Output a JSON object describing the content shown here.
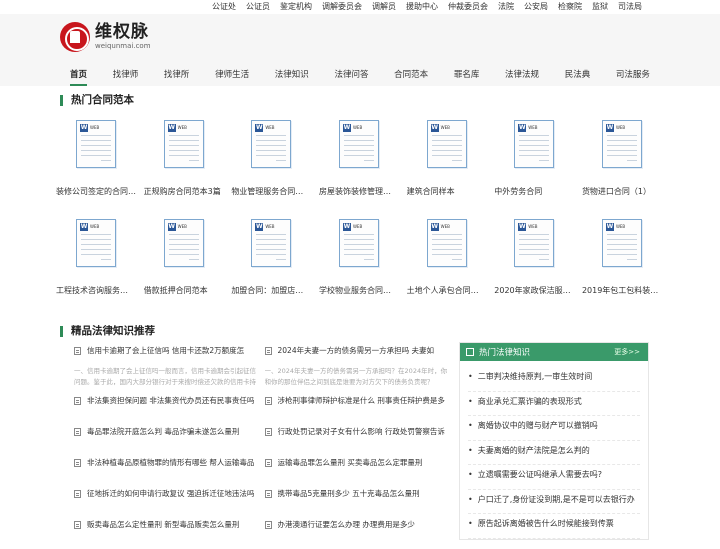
{
  "topbar": [
    "公证处",
    "公证员",
    "鉴定机构",
    "调解委员会",
    "调解员",
    "援助中心",
    "仲裁委员会",
    "法院",
    "公安局",
    "检察院",
    "监狱",
    "司法局"
  ],
  "logo": {
    "cn": "维权脉",
    "en": "weiqunmai.com"
  },
  "nav": [
    "首页",
    "找律师",
    "找律所",
    "律师生活",
    "法律知识",
    "法律问答",
    "合同范本",
    "罪名库",
    "法律法规",
    "民法典",
    "司法服务"
  ],
  "contracts": {
    "title": "热门合同范本",
    "row1": [
      "装修公司签定的合同…",
      "正规购房合同范本3篇",
      "物业管理服务合同…",
      "房屋装饰装修管理…",
      "建筑合同样本",
      "中外劳务合同",
      "货物进口合同（1）"
    ],
    "row2": [
      "工程技术咨询服务…",
      "借款抵押合同范本",
      "加盟合同：加盟店…",
      "学校物业服务合同…",
      "土地个人承包合同…",
      "2020年家政保洁服…",
      "2019年包工包料装…"
    ]
  },
  "knowledge": {
    "title": "精品法律知识推荐",
    "rows": [
      {
        "left": "信用卡逾期了会上征信吗 信用卡还款2万额度怎",
        "left_desc": "一、信用卡逾期了会上征信吗一般而言，信用卡逾期会引起征信问题。鉴于此，国内大部分银行对于来搜时偿还欠款的信用卡持卡人",
        "right": "2024年夫妻一方的债务需另一方承担吗 夫妻如",
        "right_desc": "一、2024年夫妻一方的债务需另一方承担吗？在2024年时，你和你的那位伴侣之间到底是谁要为对方欠下的债务负责呢？"
      },
      {
        "left": "非法集资担保问题 非法集资代办员还有民事责任吗",
        "right": "涉枪刑事律师辩护标准是什么 刑事责任辩护费是多"
      },
      {
        "left": "毒品罪法院开庭怎么判 毒品诈骗未遂怎么量刑",
        "right": "行政处罚记录对子女有什么影响 行政处罚警察告诉"
      },
      {
        "left": "非法种植毒品原植物罪的情形有哪些 帮人运输毒品",
        "right": "运输毒品罪怎么量刑 买卖毒品怎么定罪量刑"
      },
      {
        "left": "征地拆迁的如何申请行政复议 强迫拆迁征地违法吗",
        "right": "携带毒品5克量刑多少 五十克毒品怎么量刑"
      },
      {
        "left": "贩卖毒品怎么定性量刑 新型毒品贩卖怎么量刑",
        "right": "办港澳通行证要怎么办理 办理费用是多少"
      }
    ]
  },
  "hot": {
    "title": "热门法律知识",
    "more": "更多>>",
    "items": [
      "二审判决维持原判,一审生效时间",
      "商业承兑汇票诈骗的表现形式",
      "离婚协议中的赠与财产可以撤销吗",
      "夫妻离婚的财产法院是怎么判的",
      "立遗嘱需要公证吗继承人需要去吗?",
      "户口迁了,身份证没到期,是不是可以去银行办",
      "原告起诉离婚被告什么时候能接到传票"
    ]
  }
}
